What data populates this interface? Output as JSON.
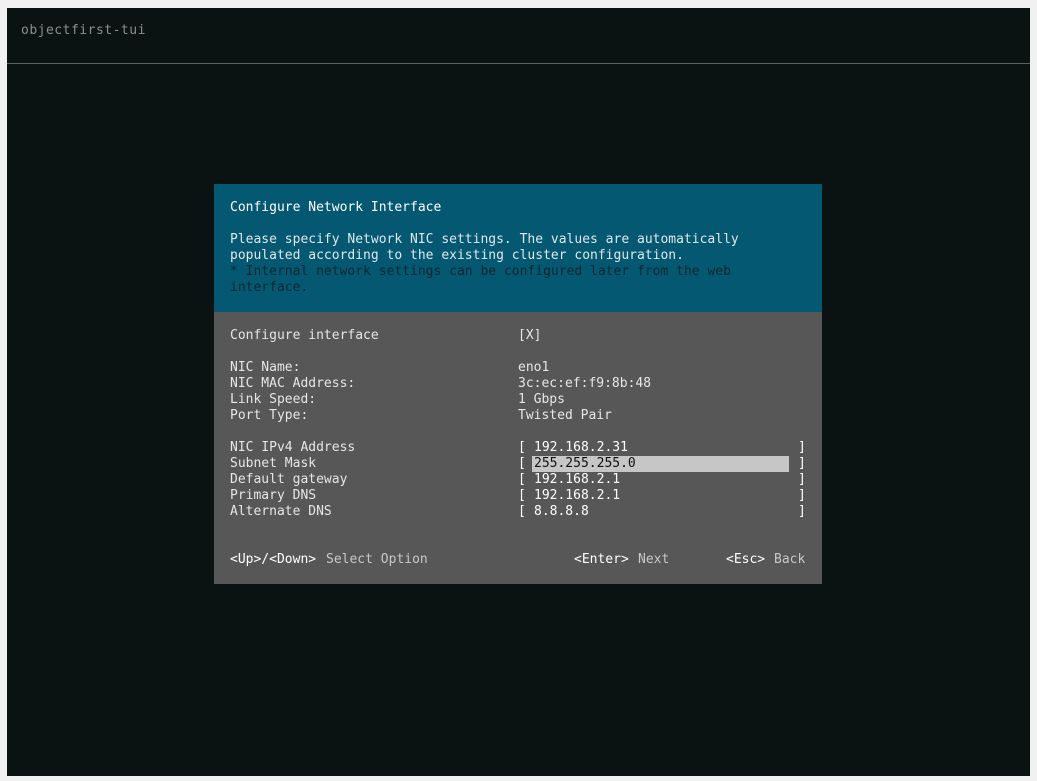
{
  "app": {
    "title": "objectfirst-tui"
  },
  "dialog": {
    "title": "Configure Network Interface",
    "description": [
      "Please specify Network NIC settings. The values are automatically",
      "populated according to the existing cluster configuration."
    ],
    "note": [
      "* Internal network settings can be configured later from the web",
      "interface."
    ],
    "configure": {
      "label": "Configure interface",
      "value": "[X]"
    },
    "info": [
      {
        "label": "NIC Name:",
        "value": "eno1"
      },
      {
        "label": "NIC MAC Address:",
        "value": "3c:ec:ef:f9:8b:48"
      },
      {
        "label": "Link Speed:",
        "value": "1 Gbps"
      },
      {
        "label": "Port Type:",
        "value": "Twisted Pair"
      }
    ],
    "fields": [
      {
        "label": "NIC IPv4 Address",
        "value": "192.168.2.31"
      },
      {
        "label": "Subnet Mask",
        "value": "255.255.255.0"
      },
      {
        "label": "Default gateway",
        "value": "192.168.2.1"
      },
      {
        "label": "Primary DNS",
        "value": "192.168.2.1"
      },
      {
        "label": "Alternate DNS",
        "value": "8.8.8.8"
      }
    ],
    "bracket_open": "[",
    "bracket_close": "]",
    "footer": {
      "nav_key": "<Up>/<Down>",
      "nav_label": "Select Option",
      "enter_key": "<Enter>",
      "enter_label": "Next",
      "esc_key": "<Esc>",
      "esc_label": "Back"
    }
  },
  "colors": {
    "screen_bg": "#0b1212",
    "header_bg": "#055872",
    "body_bg": "#575757",
    "selection_bg": "#c6c6c6"
  }
}
